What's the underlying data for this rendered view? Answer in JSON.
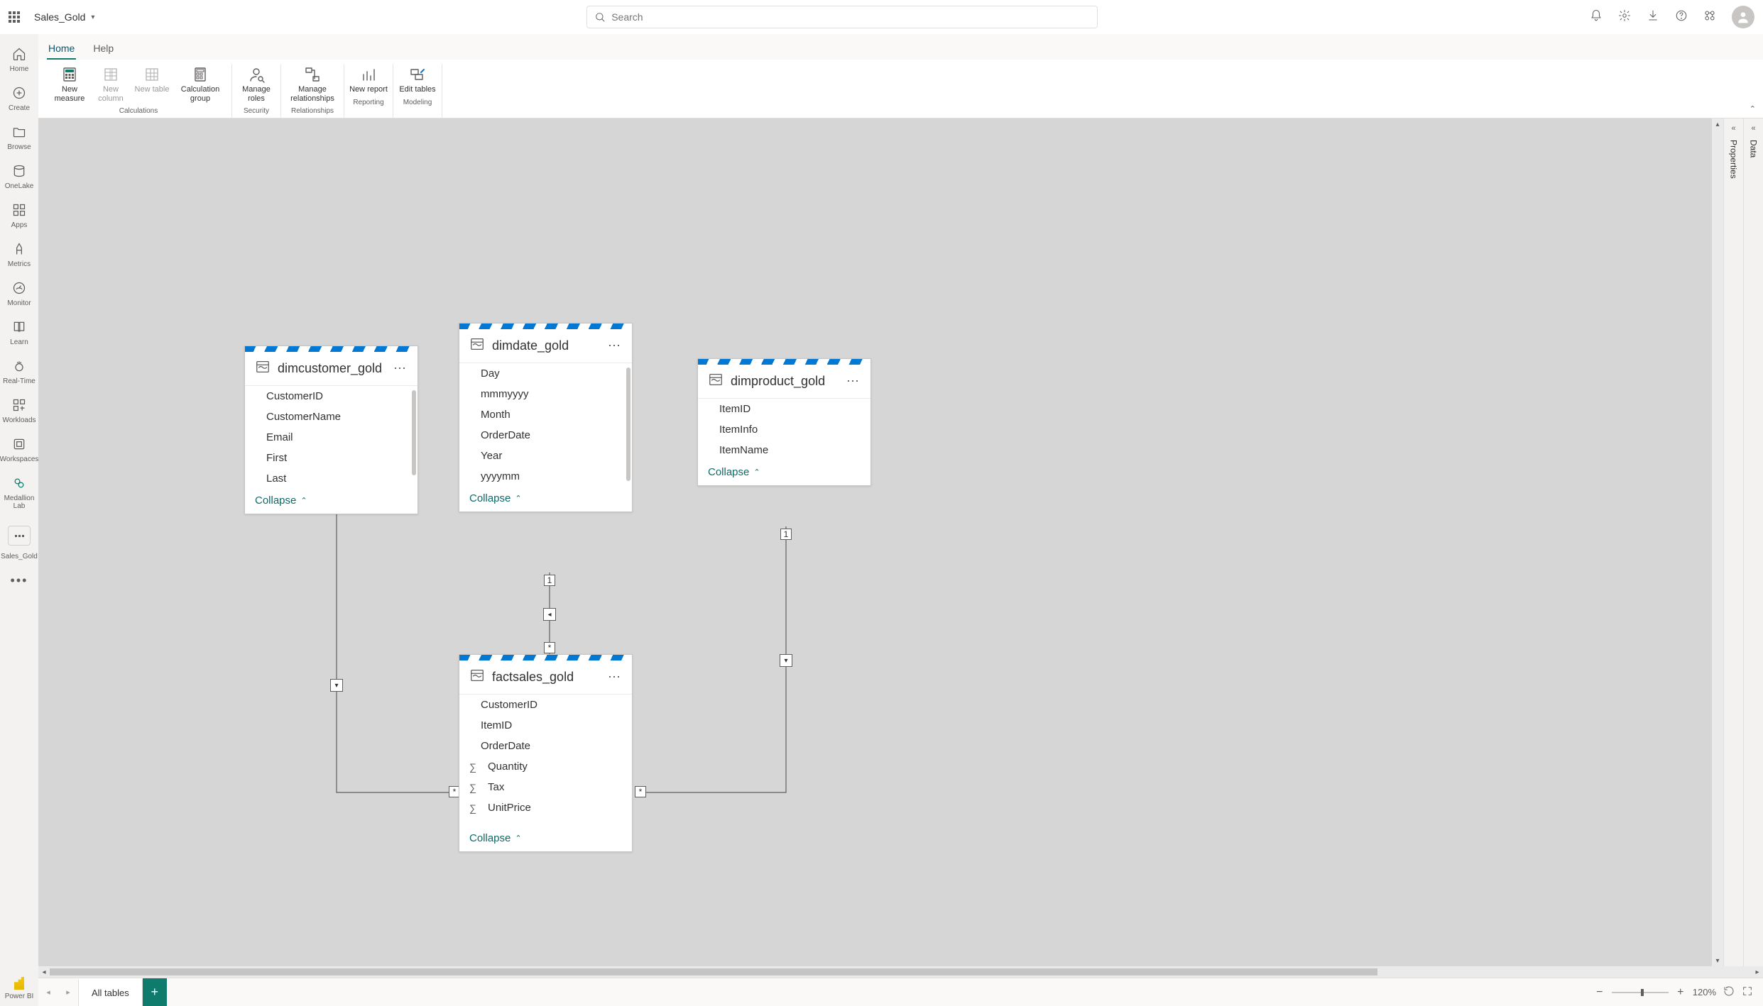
{
  "header": {
    "title": "Sales_Gold",
    "search_placeholder": "Search"
  },
  "leftRail": {
    "home": "Home",
    "create": "Create",
    "browse": "Browse",
    "onelake": "OneLake",
    "apps": "Apps",
    "metrics": "Metrics",
    "monitor": "Monitor",
    "learn": "Learn",
    "realtime": "Real-Time",
    "workloads": "Workloads",
    "workspaces": "Workspaces",
    "medallion": "Medallion Lab",
    "salesgold": "Sales_Gold",
    "powerbi": "Power BI"
  },
  "menu": {
    "home": "Home",
    "help": "Help"
  },
  "ribbon": {
    "newMeasure": "New measure",
    "newColumn": "New column",
    "newTable": "New table",
    "calcGroup": "Calculation group",
    "calcLabel": "Calculations",
    "manageRoles": "Manage roles",
    "securityLabel": "Security",
    "manageRel": "Manage relationships",
    "relLabel": "Relationships",
    "newReport": "New report",
    "reportingLabel": "Reporting",
    "editTables": "Edit tables",
    "modelingLabel": "Modeling"
  },
  "tables": {
    "dimcustomer": {
      "name": "dimcustomer_gold",
      "fields": [
        "CustomerID",
        "CustomerName",
        "Email",
        "First",
        "Last"
      ],
      "collapse": "Collapse"
    },
    "dimdate": {
      "name": "dimdate_gold",
      "fields": [
        "Day",
        "mmmyyyy",
        "Month",
        "OrderDate",
        "Year",
        "yyyymm"
      ],
      "collapse": "Collapse"
    },
    "dimproduct": {
      "name": "dimproduct_gold",
      "fields": [
        "ItemID",
        "ItemInfo",
        "ItemName"
      ],
      "collapse": "Collapse"
    },
    "factsales": {
      "name": "factsales_gold",
      "fields": [
        "CustomerID",
        "ItemID",
        "OrderDate",
        "Quantity",
        "Tax",
        "UnitPrice"
      ],
      "collapse": "Collapse"
    }
  },
  "rel": {
    "one": "1",
    "many": "*"
  },
  "rightPanes": {
    "properties": "Properties",
    "data": "Data"
  },
  "bottom": {
    "allTables": "All tables",
    "zoom": "120%"
  }
}
